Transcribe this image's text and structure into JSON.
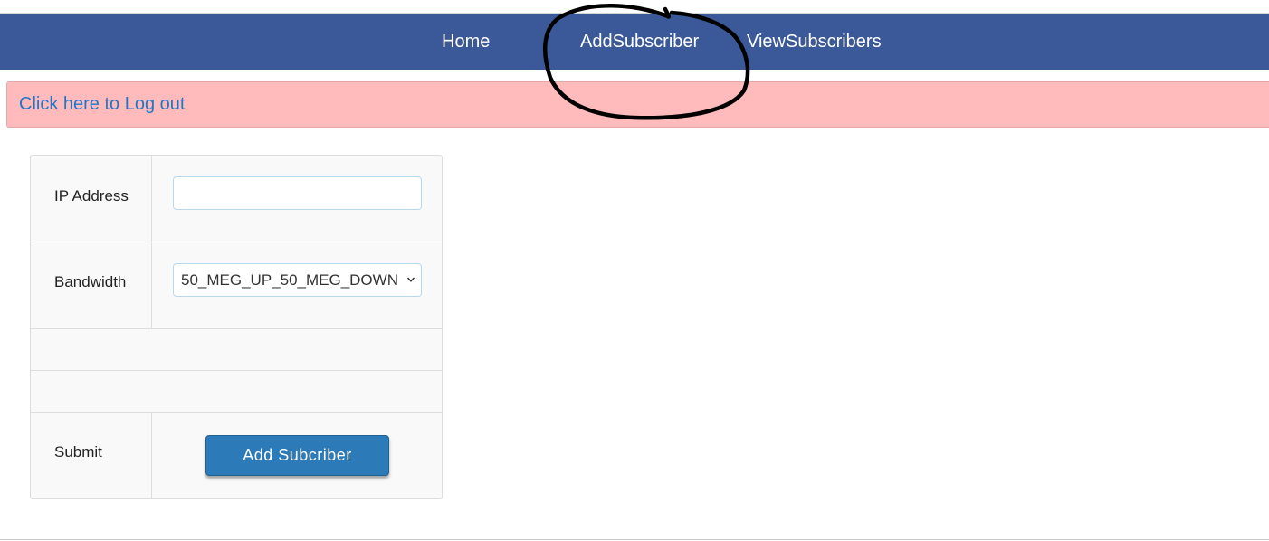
{
  "nav": {
    "items": [
      {
        "label": "Home"
      },
      {
        "label": "AddSubscriber"
      },
      {
        "label": "ViewSubscribers"
      }
    ],
    "background_color": "#3b5998"
  },
  "alert": {
    "logout_text": "Click here to Log out",
    "background_color": "#ffbbbb",
    "link_color": "#1e78c8"
  },
  "form": {
    "ip_label": "IP Address",
    "ip_value": "",
    "bandwidth_label": "Bandwidth",
    "bandwidth_selected": "50_MEG_UP_50_MEG_DOWN",
    "submit_label": "Submit",
    "submit_button": "Add Subcriber",
    "button_color": "#2d7ab8"
  },
  "annotation": {
    "shape": "hand-drawn-circle",
    "color": "#000000",
    "target": "AddSubscriber"
  }
}
